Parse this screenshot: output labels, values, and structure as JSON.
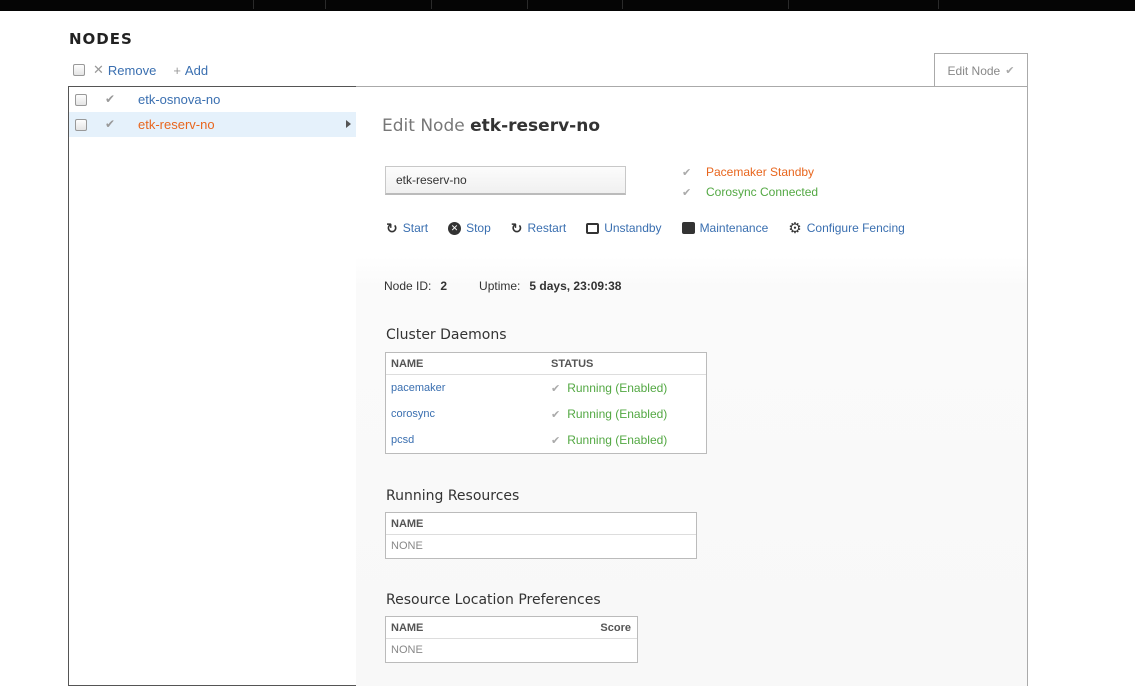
{
  "header": {
    "title": "NODES"
  },
  "toolbar": {
    "remove_label": "Remove",
    "add_label": "Add"
  },
  "nodes": [
    {
      "name": "etk-osnova-no",
      "selected": false
    },
    {
      "name": "etk-reserv-no",
      "selected": true
    }
  ],
  "tab": {
    "label": "Edit Node"
  },
  "detail": {
    "title_prefix": "Edit Node",
    "node_name": "etk-reserv-no",
    "name_input_value": "etk-reserv-no",
    "statuses": [
      {
        "text": "Pacemaker Standby",
        "color": "#e8661e"
      },
      {
        "text": "Corosync Connected",
        "color": "#53a843"
      }
    ],
    "actions": {
      "start": "Start",
      "stop": "Stop",
      "restart": "Restart",
      "unstandby": "Unstandby",
      "maintenance": "Maintenance",
      "fencing": "Configure Fencing"
    },
    "info": {
      "node_id_label": "Node ID:",
      "node_id": "2",
      "uptime_label": "Uptime:",
      "uptime": "5 days, 23:09:38"
    },
    "daemons": {
      "title": "Cluster Daemons",
      "col_name": "NAME",
      "col_status": "STATUS",
      "rows": [
        {
          "name": "pacemaker",
          "status": "Running (Enabled)"
        },
        {
          "name": "corosync",
          "status": "Running (Enabled)"
        },
        {
          "name": "pcsd",
          "status": "Running (Enabled)"
        }
      ]
    },
    "resources": {
      "title": "Running Resources",
      "col_name": "NAME",
      "empty": "NONE"
    },
    "location_prefs": {
      "title": "Resource Location Preferences",
      "col_name": "NAME",
      "col_score": "Score",
      "empty": "NONE"
    }
  },
  "colors": {
    "link": "#3a6fb0",
    "selected_node": "#e8661e",
    "selected_row_bg": "#e5f1fb",
    "ok_text": "#53a843"
  }
}
